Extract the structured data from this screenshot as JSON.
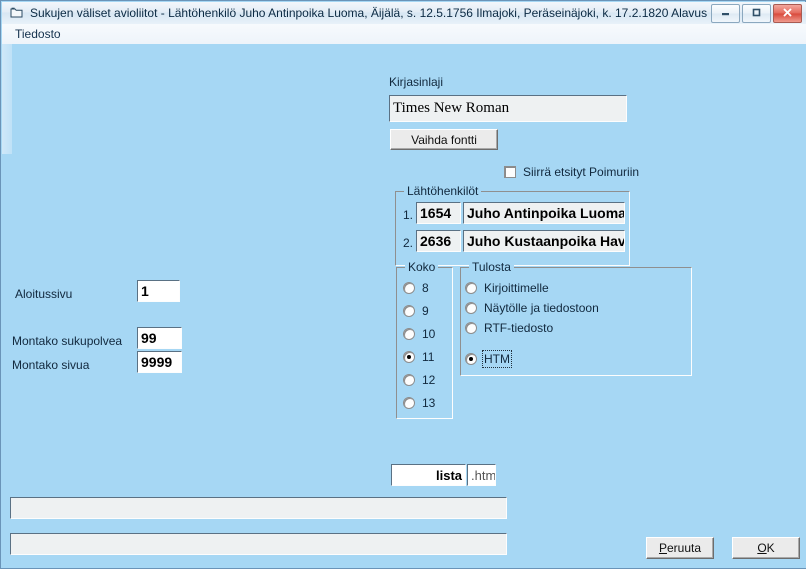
{
  "window": {
    "title": "Sukujen väliset avioliitot - Lähtöhenkilö Juho Antinpoika Luoma, Äijälä,  s. 12.5.1756 Ilmajoki, Peräseinäjoki, k. 17.2.1820 Alavus",
    "icon": "window-document-icon",
    "buttons": {
      "minimize": "minimize-icon",
      "maximize": "maximize-icon",
      "close": "close-icon"
    },
    "colors": {
      "client_background": "#a6d7f4",
      "close_button": "#d9493b",
      "field_background": "#eef1f2",
      "text": "#11283d"
    }
  },
  "menubar": {
    "items": [
      {
        "label": "Tiedosto"
      }
    ]
  },
  "font_section": {
    "label": "Kirjasinlaji",
    "font_name": "Times New Roman",
    "change_font_button": "Vaihda fontti"
  },
  "move_checkbox": {
    "label": "Siirrä etsityt Poimuriin",
    "checked": false
  },
  "start_persons": {
    "group_title": "Lähtöhenkilöt",
    "rows": [
      {
        "index": "1.",
        "id": "1654",
        "name": "Juho Antinpoika Luoma, "
      },
      {
        "index": "2.",
        "id": "2636",
        "name": "Juho Kustaanpoika Haver"
      }
    ]
  },
  "size_group": {
    "group_title": "Koko",
    "options": [
      {
        "label": "8",
        "selected": false
      },
      {
        "label": "9",
        "selected": false
      },
      {
        "label": "10",
        "selected": false
      },
      {
        "label": "11",
        "selected": true
      },
      {
        "label": "12",
        "selected": false
      },
      {
        "label": "13",
        "selected": false
      }
    ]
  },
  "output_group": {
    "group_title": "Tulosta",
    "options": [
      {
        "label": "Kirjoittimelle",
        "selected": false,
        "focused": false
      },
      {
        "label": "Näytölle ja tiedostoon",
        "selected": false,
        "focused": false
      },
      {
        "label": "RTF-tiedosto",
        "selected": false,
        "focused": false
      },
      {
        "label": "HTM",
        "selected": true,
        "focused": true
      }
    ]
  },
  "page_settings": {
    "start_page_label": "Aloitussivu",
    "start_page_value": "1",
    "generations_label": "Montako sukupolvea",
    "generations_value": "99",
    "pages_label": "Montako sivua",
    "pages_value": "9999"
  },
  "filename": {
    "name_value": "lista",
    "extension_value": ".htm"
  },
  "status_bars": [
    {
      "text": ""
    },
    {
      "text": ""
    }
  ],
  "actions": {
    "cancel": {
      "prefix": "P",
      "rest": "eruuta"
    },
    "ok": {
      "prefix": "O",
      "rest": "K"
    }
  }
}
